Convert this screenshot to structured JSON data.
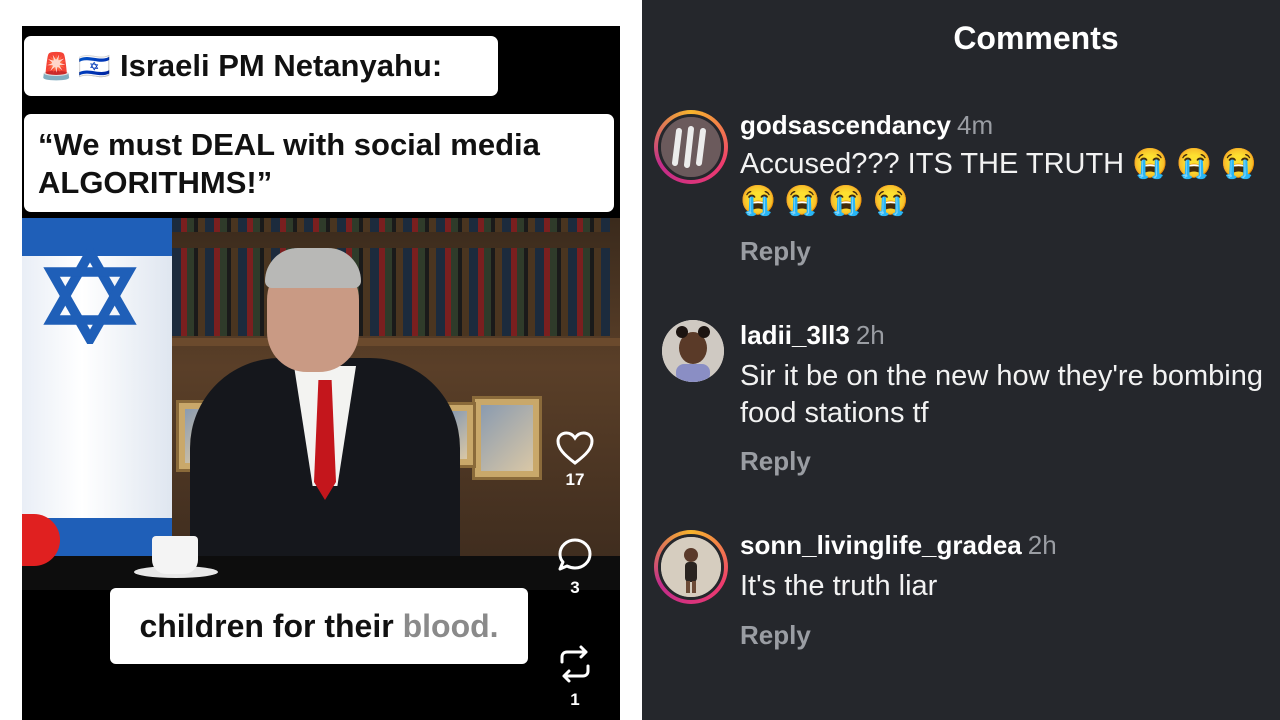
{
  "video": {
    "title_flags": [
      "🚨",
      "🇮🇱"
    ],
    "title_line1": "Israeli PM Netanyahu:",
    "title_line2a": "“We must DEAL with social media",
    "title_line2b": "ALGORITHMS!”",
    "caption_main": "children for their",
    "caption_fade": "blood.",
    "like_count": "17",
    "comment_count": "3",
    "repost_count": "1",
    "like_icon": "heart-icon",
    "comment_icon": "comment-bubble-icon",
    "repost_icon": "repost-icon"
  },
  "comments_panel": {
    "title": "Comments",
    "background_color": "#25272c",
    "items": [
      {
        "username": "godsascendancy",
        "time": "4m",
        "text": "Accused??? ITS THE TRUTH 😭 😭 😭 😭 😭 😭 😭",
        "reply_label": "Reply",
        "avatar_ring": true
      },
      {
        "username": "ladii_3ll3",
        "time": "2h",
        "text": "Sir it be on the new how they're bombing food stations tf",
        "reply_label": "Reply",
        "avatar_ring": false
      },
      {
        "username": "sonn_livinglife_gradea",
        "time": "2h",
        "text": "It's the truth liar",
        "reply_label": "Reply",
        "avatar_ring": true
      }
    ]
  }
}
